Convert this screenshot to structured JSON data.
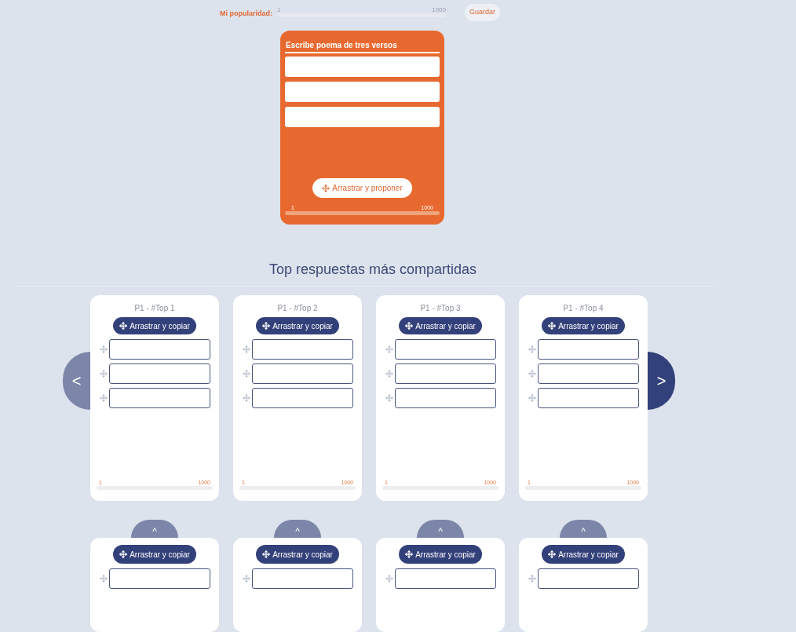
{
  "popularity": {
    "label": "Mi popularidad:",
    "min_label": "1",
    "max_label": "1000",
    "save_button": "Guardar"
  },
  "composer": {
    "title": "Escribe poema de tres versos",
    "verses": [
      {
        "kind": "input"
      },
      {
        "kind": "input"
      },
      {
        "kind": "input"
      }
    ],
    "button": "Arrastrar y proponer",
    "min_label": "1",
    "max_label": "1000"
  },
  "section_title": "Top respuestas más compartidas",
  "prev_button": "<",
  "next_button": ">",
  "cards": [
    {
      "title": "P1 - #Top 1",
      "button": "Arrastrar y copiar",
      "verses": [
        {
          "kind": "input"
        },
        {
          "kind": "input"
        },
        {
          "kind": "input"
        }
      ],
      "min_label": "1",
      "max_label": "1000"
    },
    {
      "title": "P1 - #Top 2",
      "button": "Arrastrar y copiar",
      "verses": [
        {
          "kind": "input"
        },
        {
          "kind": "input"
        },
        {
          "kind": "input"
        }
      ],
      "min_label": "1",
      "max_label": "1000"
    },
    {
      "title": "P1 - #Top 3",
      "button": "Arrastrar y copiar",
      "verses": [
        {
          "kind": "input"
        },
        {
          "kind": "input"
        },
        {
          "kind": "input"
        }
      ],
      "min_label": "1",
      "max_label": "1000"
    },
    {
      "title": "P1 - #Top 4",
      "button": "Arrastrar y copiar",
      "verses": [
        {
          "kind": "input"
        },
        {
          "kind": "input"
        },
        {
          "kind": "input"
        }
      ],
      "min_label": "1",
      "max_label": "1000"
    }
  ],
  "more_cards": [
    {
      "toggle": "^",
      "button": "Arrastrar y copiar"
    },
    {
      "toggle": "^",
      "button": "Arrastrar y copiar"
    },
    {
      "toggle": "^",
      "button": "Arrastrar y copiar"
    },
    {
      "toggle": "^",
      "button": "Arrastrar y copiar"
    }
  ]
}
